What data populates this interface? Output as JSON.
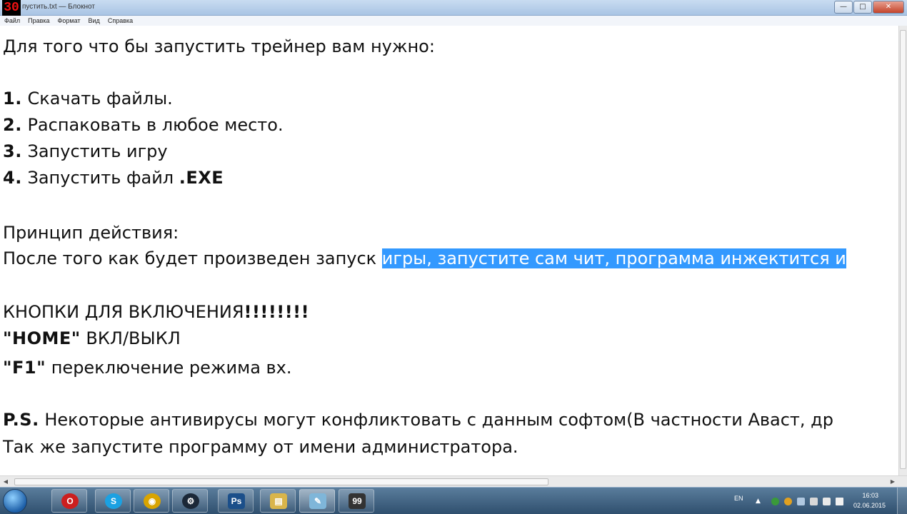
{
  "window": {
    "logo_text": "30",
    "title": "пустить.txt — Блокнот",
    "minimize_glyph": "—",
    "maximize_glyph": "□",
    "close_glyph": "✕"
  },
  "menu": [
    "Файл",
    "Правка",
    "Формат",
    "Вид",
    "Справка"
  ],
  "document": {
    "line1": "Для того что бы запустить трейнер вам нужно:",
    "step1_num": "1.",
    "step1_text": " Скачать файлы.",
    "step2_num": "2.",
    "step2_text": " Распаковать в любое место.",
    "step3_num": "3.",
    "step3_text": " Запустить игру",
    "step4_num": "4.",
    "step4_text": " Запустить файл ",
    "step4_ext": ".EXE",
    "principle_label": "Принцип действия:",
    "principle_text": "После того как будет произведен запуск ",
    "principle_selected": "игры, запустите сам чит, программа инжектится и",
    "buttons_heading": "КНОПКИ ДЛЯ ВКЛЮЧЕНИЯ",
    "buttons_heading_excl": "!!!!!!!!",
    "home_key": "\"HOME\"",
    "home_desc": " ВКЛ/ВЫКЛ",
    "f1_key": "\"F1\"",
    "f1_desc": " переключение режима вх.",
    "ps_label": "P.S.",
    "ps_text": " Некоторые антивирусы могут конфликтовать с данным софтом(В частности Аваст, др",
    "admin_line": "Так же запустите программу от имени администратора."
  },
  "taskbar": {
    "apps": [
      {
        "name": "opera",
        "glyph": "O",
        "color": "#cc1f1f"
      },
      {
        "name": "skype",
        "glyph": "S",
        "color": "#1ba1e2"
      },
      {
        "name": "chrome",
        "glyph": "◉",
        "color": "#d9a400"
      },
      {
        "name": "steam",
        "glyph": "⚙",
        "color": "#1b2838"
      },
      {
        "name": "photoshop",
        "glyph": "Ps",
        "color": "#1b4f8a"
      },
      {
        "name": "explorer",
        "glyph": "▤",
        "color": "#d9b54a"
      },
      {
        "name": "notepad",
        "glyph": "✎",
        "color": "#7fb6d9"
      },
      {
        "name": "game",
        "glyph": "99",
        "color": "#333333"
      }
    ],
    "language": "EN",
    "time": "16:03",
    "date": "02.06.2015"
  }
}
